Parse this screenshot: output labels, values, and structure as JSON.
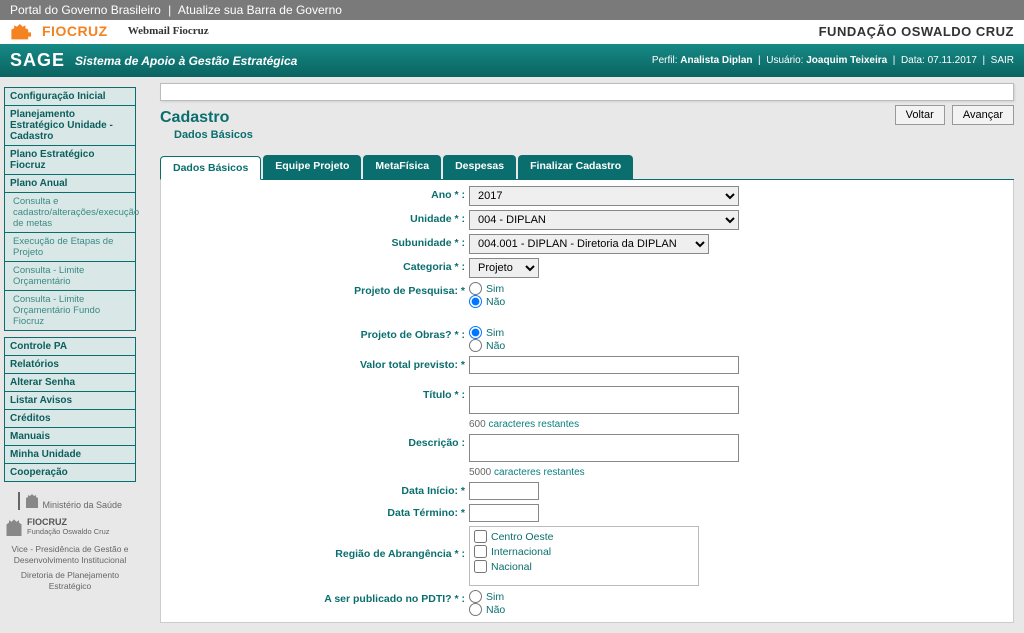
{
  "gov_bar": {
    "portal": "Portal do Governo Brasileiro",
    "atualize": "Atualize sua Barra de Governo"
  },
  "header": {
    "brand": "FIOCRUZ",
    "webmail": "Webmail Fiocruz",
    "fundacao": "FUNDAÇÃO OSWALDO CRUZ"
  },
  "sage": {
    "logo": "SAGE",
    "subtitle": "Sistema de Apoio à Gestão Estratégica",
    "perfil_lbl": "Perfil:",
    "perfil_val": "Analista Diplan",
    "usuario_lbl": "Usuário:",
    "usuario_val": "Joaquim Teixeira",
    "data_lbl": "Data:",
    "data_val": "07.11.2017",
    "sair": "SAIR"
  },
  "sidebar": {
    "items": [
      {
        "label": "Configuração Inicial",
        "bold": true
      },
      {
        "label": "Planejamento Estratégico Unidade - Cadastro",
        "bold": true
      },
      {
        "label": "Plano Estratégico Fiocruz",
        "bold": true
      },
      {
        "label": "Plano Anual",
        "bold": true
      },
      {
        "label": "Consulta e cadastro/alterações/execução de metas",
        "sub": true
      },
      {
        "label": "Execução de Etapas de Projeto",
        "sub": true
      },
      {
        "label": "Consulta - Limite Orçamentário",
        "sub": true
      },
      {
        "label": "Consulta - Limite Orçamentário Fundo Fiocruz",
        "sub": true
      }
    ],
    "group2": [
      {
        "label": "Controle PA",
        "bold": true
      },
      {
        "label": "Relatórios",
        "bold": true
      },
      {
        "label": "Alterar Senha",
        "bold": true
      },
      {
        "label": "Listar Avisos",
        "bold": true
      },
      {
        "label": "Créditos",
        "bold": true
      },
      {
        "label": "Manuais",
        "bold": true
      },
      {
        "label": "Minha Unidade",
        "bold": true
      },
      {
        "label": "Cooperação",
        "bold": true
      }
    ]
  },
  "footer": {
    "ministerio": "Ministério da Saúde",
    "fiocruz_brand": "FIOCRUZ",
    "fiocruz_sub": "Fundação Oswaldo Cruz",
    "vice": "Vice - Presidência de Gestão e Desenvolvimento Institucional",
    "diretoria": "Diretoria de Planejamento Estratégico"
  },
  "page": {
    "title": "Cadastro",
    "subtitle": "Dados Básicos",
    "voltar": "Voltar",
    "avancar": "Avançar"
  },
  "tabs": {
    "t1": "Dados Básicos",
    "t2": "Equipe Projeto",
    "t3": "MetaFísica",
    "t4": "Despesas",
    "t5": "Finalizar Cadastro"
  },
  "form": {
    "ano_lbl": "Ano * :",
    "ano_val": "2017",
    "unidade_lbl": "Unidade * :",
    "unidade_val": "004 - DIPLAN",
    "subunidade_lbl": "Subunidade * :",
    "subunidade_val": "004.001 - DIPLAN - Diretoria da DIPLAN",
    "categoria_lbl": "Categoria * :",
    "categoria_val": "Projeto",
    "pesquisa_lbl": "Projeto de Pesquisa: *",
    "sim": "Sim",
    "nao": "Não",
    "obras_lbl": "Projeto de Obras? * :",
    "valor_lbl": "Valor total previsto: *",
    "titulo_lbl": "Título * :",
    "titulo_hint_num": "600",
    "caracteres_restantes": "caracteres restantes",
    "descricao_lbl": "Descrição :",
    "descricao_hint_num": "5000",
    "data_inicio_lbl": "Data Início: *",
    "data_termino_lbl": "Data Término: *",
    "regiao_lbl": "Região de Abrangência * :",
    "regiao_opts": [
      "Centro Oeste",
      "Internacional",
      "Nacional"
    ],
    "pdti_lbl": "A ser publicado no PDTI? * :"
  }
}
